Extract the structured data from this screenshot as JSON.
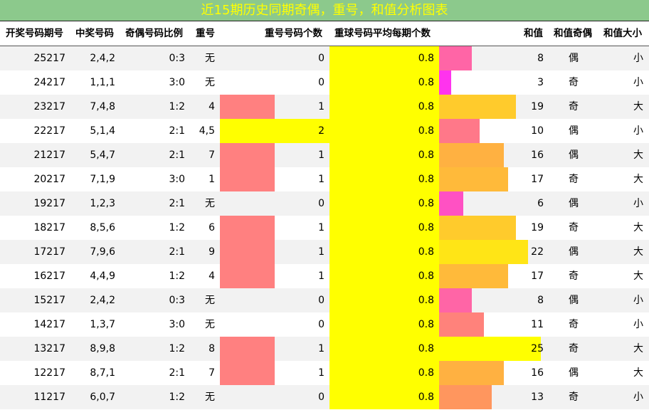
{
  "title": "近15期历史同期奇偶，重号，和值分析图表",
  "headers": {
    "issue": "开奖号码期号",
    "numbers": "中奖号码",
    "ratio": "奇偶号码比例",
    "repeat": "重号",
    "repeat_count": "重号号码个数",
    "avg": "重球号码平均每期个数",
    "sum": "和值",
    "sum_parity": "和值奇偶",
    "sum_size": "和值大小"
  },
  "colors": {
    "title_bg": "#8cc98c",
    "title_text": "#ffff00",
    "repeat_bar": "#ff8080",
    "repeat_bar_max": "#ffff00",
    "avg_bar": "#ffff00",
    "sum_low": "#ff33ee",
    "sum_mid": "#ffa050",
    "sum_high": "#ffff00"
  },
  "chart_data": {
    "type": "table",
    "sum_bar_scale_max": 27,
    "repeat_bar_scale_max": 2,
    "rows": [
      {
        "issue": "25217",
        "numbers": "2,4,2",
        "ratio": "0:3",
        "repeat": "无",
        "repeat_count": 0,
        "avg": 0.8,
        "sum": 8,
        "sum_parity": "偶",
        "sum_size": "小"
      },
      {
        "issue": "24217",
        "numbers": "1,1,1",
        "ratio": "3:0",
        "repeat": "无",
        "repeat_count": 0,
        "avg": 0.8,
        "sum": 3,
        "sum_parity": "奇",
        "sum_size": "小"
      },
      {
        "issue": "23217",
        "numbers": "7,4,8",
        "ratio": "1:2",
        "repeat": "4",
        "repeat_count": 1,
        "avg": 0.8,
        "sum": 19,
        "sum_parity": "奇",
        "sum_size": "大"
      },
      {
        "issue": "22217",
        "numbers": "5,1,4",
        "ratio": "2:1",
        "repeat": "4,5",
        "repeat_count": 2,
        "avg": 0.8,
        "sum": 10,
        "sum_parity": "偶",
        "sum_size": "小"
      },
      {
        "issue": "21217",
        "numbers": "5,4,7",
        "ratio": "2:1",
        "repeat": "7",
        "repeat_count": 1,
        "avg": 0.8,
        "sum": 16,
        "sum_parity": "偶",
        "sum_size": "大"
      },
      {
        "issue": "20217",
        "numbers": "7,1,9",
        "ratio": "3:0",
        "repeat": "1",
        "repeat_count": 1,
        "avg": 0.8,
        "sum": 17,
        "sum_parity": "奇",
        "sum_size": "大"
      },
      {
        "issue": "19217",
        "numbers": "1,2,3",
        "ratio": "2:1",
        "repeat": "无",
        "repeat_count": 0,
        "avg": 0.8,
        "sum": 6,
        "sum_parity": "偶",
        "sum_size": "小"
      },
      {
        "issue": "18217",
        "numbers": "8,5,6",
        "ratio": "1:2",
        "repeat": "6",
        "repeat_count": 1,
        "avg": 0.8,
        "sum": 19,
        "sum_parity": "奇",
        "sum_size": "大"
      },
      {
        "issue": "17217",
        "numbers": "7,9,6",
        "ratio": "2:1",
        "repeat": "9",
        "repeat_count": 1,
        "avg": 0.8,
        "sum": 22,
        "sum_parity": "偶",
        "sum_size": "大"
      },
      {
        "issue": "16217",
        "numbers": "4,4,9",
        "ratio": "1:2",
        "repeat": "4",
        "repeat_count": 1,
        "avg": 0.8,
        "sum": 17,
        "sum_parity": "奇",
        "sum_size": "大"
      },
      {
        "issue": "15217",
        "numbers": "2,4,2",
        "ratio": "0:3",
        "repeat": "无",
        "repeat_count": 0,
        "avg": 0.8,
        "sum": 8,
        "sum_parity": "偶",
        "sum_size": "小"
      },
      {
        "issue": "14217",
        "numbers": "1,3,7",
        "ratio": "3:0",
        "repeat": "无",
        "repeat_count": 0,
        "avg": 0.8,
        "sum": 11,
        "sum_parity": "奇",
        "sum_size": "小"
      },
      {
        "issue": "13217",
        "numbers": "8,9,8",
        "ratio": "1:2",
        "repeat": "8",
        "repeat_count": 1,
        "avg": 0.8,
        "sum": 25,
        "sum_parity": "奇",
        "sum_size": "大"
      },
      {
        "issue": "12217",
        "numbers": "8,7,1",
        "ratio": "2:1",
        "repeat": "7",
        "repeat_count": 1,
        "avg": 0.8,
        "sum": 16,
        "sum_parity": "偶",
        "sum_size": "大"
      },
      {
        "issue": "11217",
        "numbers": "6,0,7",
        "ratio": "1:2",
        "repeat": "无",
        "repeat_count": 0,
        "avg": 0.8,
        "sum": 13,
        "sum_parity": "奇",
        "sum_size": "小"
      }
    ]
  }
}
